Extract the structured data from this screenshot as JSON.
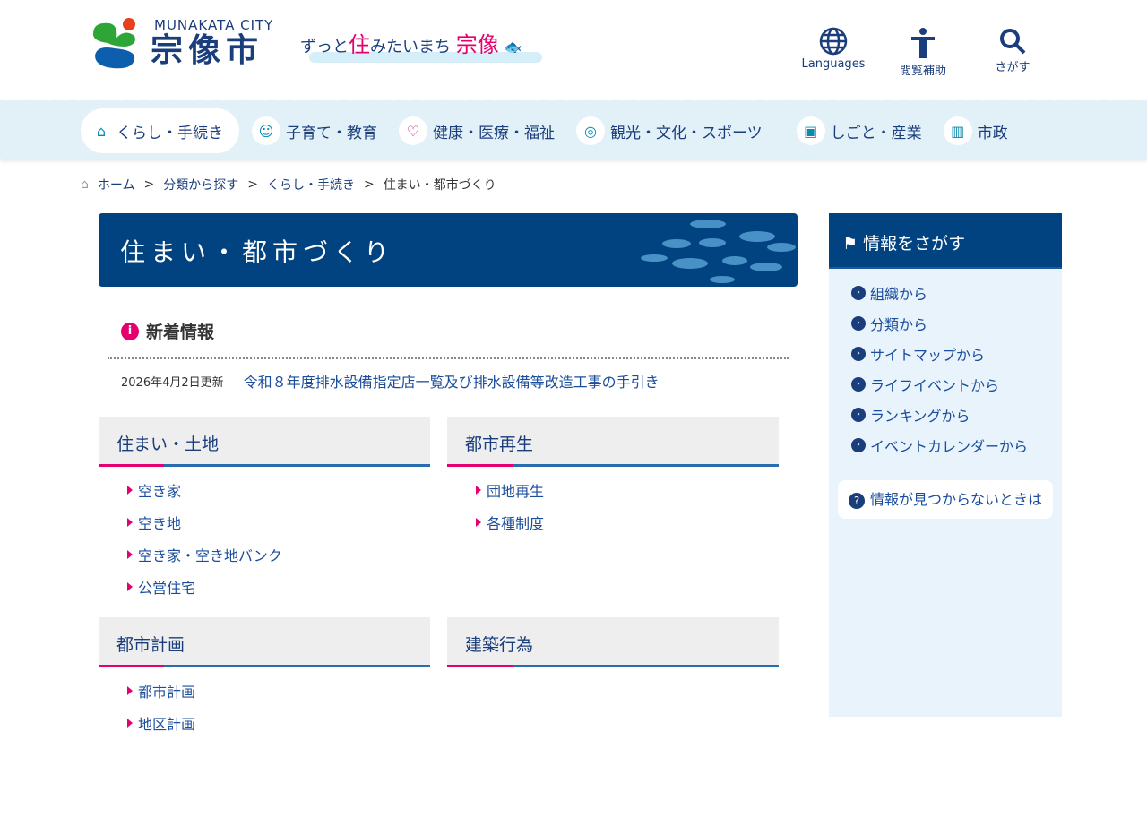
{
  "header": {
    "logo_en": "MUNAKATA CITY",
    "logo_jp": "宗像市",
    "slogan_a": "ずっと",
    "slogan_b": "住",
    "slogan_c": "みたいまち",
    "slogan_d": "宗像",
    "icons": [
      {
        "label": "Languages",
        "icon": "globe-icon"
      },
      {
        "label": "閲覧補助",
        "icon": "accessibility-icon"
      },
      {
        "label": "さがす",
        "icon": "search-icon"
      }
    ]
  },
  "nav": [
    {
      "label": "くらし・手続き",
      "icon": "house-icon"
    },
    {
      "label": "子育て・教育",
      "icon": "baby-icon"
    },
    {
      "label": "健康・医療・福祉",
      "icon": "heart-hand-icon"
    },
    {
      "label": "観光・文化・スポーツ",
      "icon": "camera-icon"
    },
    {
      "label": "しごと・産業",
      "icon": "briefcase-icon"
    },
    {
      "label": "市政",
      "icon": "building-icon"
    }
  ],
  "breadcrumb": [
    "ホーム",
    "分類から探す",
    "くらし・手続き",
    "住まい・都市づくり"
  ],
  "page_title": "住まい・都市づくり",
  "news": {
    "heading": "新着情報",
    "items": [
      {
        "date": "2026年4月2日更新",
        "title": "令和８年度排水設備指定店一覧及び排水設備等改造工事の手引き"
      }
    ]
  },
  "categories": [
    {
      "title": "住まい・土地",
      "links": [
        "空き家",
        "空き地",
        "空き家・空き地バンク",
        "公営住宅"
      ]
    },
    {
      "title": "都市再生",
      "links": [
        "団地再生",
        "各種制度"
      ]
    },
    {
      "title": "都市計画",
      "links": [
        "都市計画",
        "地区計画"
      ]
    },
    {
      "title": "建築行為",
      "links": []
    }
  ],
  "sidebar": {
    "heading": "情報をさがす",
    "links": [
      "組織から",
      "分類から",
      "サイトマップから",
      "ライフイベントから",
      "ランキングから",
      "イベントカレンダーから"
    ],
    "notfound": "情報が見つからないときは"
  }
}
